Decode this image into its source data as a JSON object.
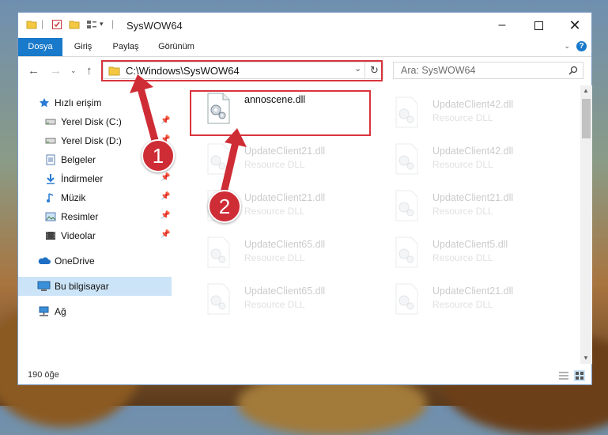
{
  "window": {
    "title": "SysWOW64"
  },
  "ribbon": {
    "tabs": [
      "Dosya",
      "Giriş",
      "Paylaş",
      "Görünüm"
    ]
  },
  "address": {
    "path": "C:\\Windows\\SysWOW64"
  },
  "search": {
    "placeholder": "Ara: SysWOW64"
  },
  "sidebar": {
    "items": [
      {
        "label": "Hızlı erişim",
        "icon": "star-icon"
      },
      {
        "label": "Yerel Disk (C:)",
        "icon": "drive-icon",
        "pinned": true
      },
      {
        "label": "Yerel Disk (D:)",
        "icon": "drive-icon",
        "pinned": true
      },
      {
        "label": "Belgeler",
        "icon": "documents-icon",
        "pinned": true
      },
      {
        "label": "İndirmeler",
        "icon": "download-icon",
        "pinned": true
      },
      {
        "label": "Müzik",
        "icon": "music-icon",
        "pinned": true
      },
      {
        "label": "Resimler",
        "icon": "pictures-icon",
        "pinned": true
      },
      {
        "label": "Videolar",
        "icon": "videos-icon",
        "pinned": true
      },
      {
        "label": "OneDrive",
        "icon": "cloud-icon"
      },
      {
        "label": "Bu bilgisayar",
        "icon": "computer-icon",
        "selected": true
      },
      {
        "label": "Ağ",
        "icon": "network-icon"
      }
    ]
  },
  "files": {
    "selected": {
      "name": "annoscene.dll",
      "type": ""
    },
    "column1": [
      {
        "name": "UpdateClient21.dll",
        "type": "Resource DLL"
      },
      {
        "name": "UpdateClient21.dll",
        "type": "Resource DLL"
      },
      {
        "name": "UpdateClient65.dll",
        "type": "Resource DLL"
      },
      {
        "name": "UpdateClient65.dll",
        "type": "Resource DLL"
      }
    ],
    "column2": [
      {
        "name": "UpdateClient42.dll",
        "type": "Resource DLL"
      },
      {
        "name": "UpdateClient42.dll",
        "type": "Resource DLL"
      },
      {
        "name": "UpdateClient21.dll",
        "type": "Resource DLL"
      },
      {
        "name": "UpdateClient5.dll",
        "type": "Resource DLL"
      },
      {
        "name": "UpdateClient21.dll",
        "type": "Resource DLL"
      }
    ]
  },
  "status": {
    "count": "190 öğe"
  },
  "annotations": {
    "step1": "1",
    "step2": "2",
    "color": "#d9343d"
  }
}
